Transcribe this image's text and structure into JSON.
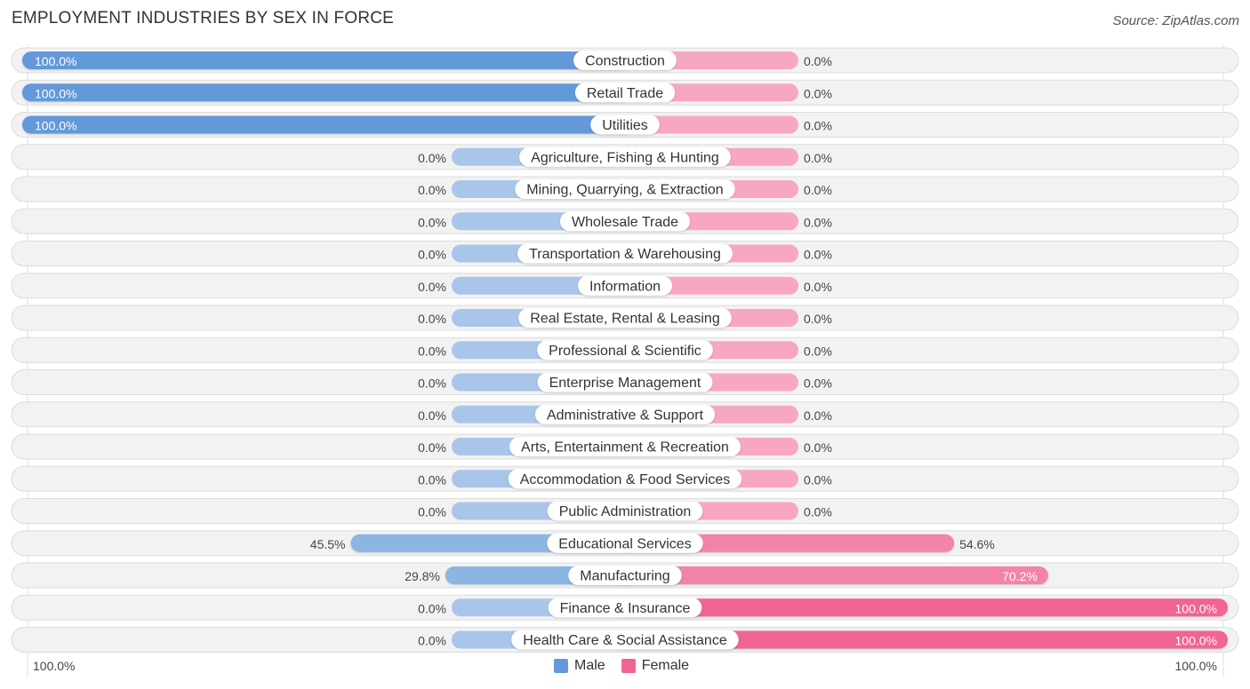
{
  "header": {
    "title": "EMPLOYMENT INDUSTRIES BY SEX IN FORCE",
    "source": "Source: ZipAtlas.com"
  },
  "colors": {
    "male_strong": "#6399d8",
    "male_light": "#a9c6ea",
    "female_strong": "#f06592",
    "female_light": "#f7a8c0",
    "track": "#f2f2f2"
  },
  "legend": [
    {
      "label": "Male",
      "color": "#6399d8"
    },
    {
      "label": "Female",
      "color": "#f06592"
    }
  ],
  "axis": {
    "left_label": "100.0%",
    "right_label": "100.0%"
  },
  "chart_data": {
    "type": "bar",
    "orientation": "horizontal-diverging",
    "title": "EMPLOYMENT INDUSTRIES BY SEX IN FORCE",
    "xlabel": "",
    "ylabel": "",
    "xlim": [
      -100,
      100
    ],
    "legend_position": "bottom-center",
    "categories": [
      "Construction",
      "Retail Trade",
      "Utilities",
      "Agriculture, Fishing & Hunting",
      "Mining, Quarrying, & Extraction",
      "Wholesale Trade",
      "Transportation & Warehousing",
      "Information",
      "Real Estate, Rental & Leasing",
      "Professional & Scientific",
      "Enterprise Management",
      "Administrative & Support",
      "Arts, Entertainment & Recreation",
      "Accommodation & Food Services",
      "Public Administration",
      "Educational Services",
      "Manufacturing",
      "Finance & Insurance",
      "Health Care & Social Assistance"
    ],
    "series": [
      {
        "name": "Male",
        "values": [
          100.0,
          100.0,
          100.0,
          0.0,
          0.0,
          0.0,
          0.0,
          0.0,
          0.0,
          0.0,
          0.0,
          0.0,
          0.0,
          0.0,
          0.0,
          45.5,
          29.8,
          0.0,
          0.0
        ],
        "labels": [
          "100.0%",
          "100.0%",
          "100.0%",
          "0.0%",
          "0.0%",
          "0.0%",
          "0.0%",
          "0.0%",
          "0.0%",
          "0.0%",
          "0.0%",
          "0.0%",
          "0.0%",
          "0.0%",
          "0.0%",
          "45.5%",
          "29.8%",
          "0.0%",
          "0.0%"
        ]
      },
      {
        "name": "Female",
        "values": [
          0.0,
          0.0,
          0.0,
          0.0,
          0.0,
          0.0,
          0.0,
          0.0,
          0.0,
          0.0,
          0.0,
          0.0,
          0.0,
          0.0,
          0.0,
          54.6,
          70.2,
          100.0,
          100.0
        ],
        "labels": [
          "0.0%",
          "0.0%",
          "0.0%",
          "0.0%",
          "0.0%",
          "0.0%",
          "0.0%",
          "0.0%",
          "0.0%",
          "0.0%",
          "0.0%",
          "0.0%",
          "0.0%",
          "0.0%",
          "0.0%",
          "54.6%",
          "70.2%",
          "100.0%",
          "100.0%"
        ]
      }
    ]
  }
}
